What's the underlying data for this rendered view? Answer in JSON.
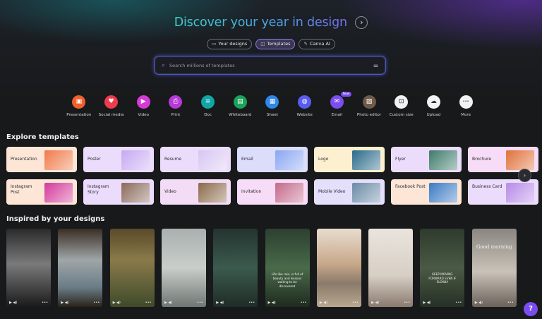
{
  "hero": {
    "title": "Discover your year in design",
    "arrow": "›"
  },
  "pills": [
    {
      "label": "Your designs",
      "icon": "folder-icon",
      "glyph": "▭"
    },
    {
      "label": "Templates",
      "icon": "templates-icon",
      "glyph": "◫"
    },
    {
      "label": "Canva AI",
      "icon": "canva-ai-icon",
      "glyph": "✎"
    }
  ],
  "search": {
    "placeholder": "Search millions of templates",
    "value": ""
  },
  "categories": [
    {
      "label": "Presentation",
      "color": "#f0602c",
      "glyph": "▣"
    },
    {
      "label": "Social media",
      "color": "#ef3b4b",
      "glyph": "♥"
    },
    {
      "label": "Video",
      "color": "#d63ad6",
      "glyph": "▶"
    },
    {
      "label": "Print",
      "color": "#b53ad6",
      "glyph": "⎙"
    },
    {
      "label": "Doc",
      "color": "#10a6a6",
      "glyph": "≡"
    },
    {
      "label": "Whiteboard",
      "color": "#1aa35a",
      "glyph": "▤"
    },
    {
      "label": "Sheet",
      "color": "#2f87e8",
      "glyph": "▦"
    },
    {
      "label": "Website",
      "color": "#5a5cf0",
      "glyph": "◍"
    },
    {
      "label": "Email",
      "color": "#7b4dee",
      "glyph": "✉",
      "badge": "New"
    },
    {
      "label": "Photo editor",
      "color": "#6f5a48",
      "glyph": "▨"
    },
    {
      "label": "Custom size",
      "color": "#f2f2f2",
      "glyph": "⊡"
    },
    {
      "label": "Upload",
      "color": "#f2f2f2",
      "glyph": "☁"
    },
    {
      "label": "More",
      "color": "#f2f2f2",
      "glyph": "•••"
    }
  ],
  "explore": {
    "title": "Explore templates",
    "scroll": "›"
  },
  "templates": [
    {
      "label": "Presentation",
      "bg": "#fde6d6",
      "thumb": "#f07a4a"
    },
    {
      "label": "Poster",
      "bg": "#ecdcfb",
      "thumb": "#c6a9f2"
    },
    {
      "label": "Resume",
      "bg": "#ecdcfb",
      "thumb": "#d7c6f2"
    },
    {
      "label": "Email",
      "bg": "#dcdcfb",
      "thumb": "#8aa6f2"
    },
    {
      "label": "Logo",
      "bg": "#fdf0d0",
      "thumb": "#2a6a8a"
    },
    {
      "label": "Flyer",
      "bg": "#ecdcfb",
      "thumb": "#3d7a6a"
    },
    {
      "label": "Brochure",
      "bg": "#f6dcf6",
      "thumb": "#e0713a"
    },
    {
      "label": "Instagram Post",
      "bg": "#fde6d6",
      "thumb": "#d43a9a"
    },
    {
      "label": "Instagram Story",
      "bg": "#ecdcfb",
      "thumb": "#8a6a5a"
    },
    {
      "label": "Video",
      "bg": "#f3dcf6",
      "thumb": "#8a6a4a"
    },
    {
      "label": "Invitation",
      "bg": "#f6dcf6",
      "thumb": "#c46a8a"
    },
    {
      "label": "Mobile Video",
      "bg": "#e4e0fb",
      "thumb": "#6a8aa6"
    },
    {
      "label": "Facebook Post",
      "bg": "#fde6d6",
      "thumb": "#3a7ac4"
    },
    {
      "label": "Business Card",
      "bg": "#ecdcfb",
      "thumb": "#b78ae8"
    }
  ],
  "inspired": {
    "title": "Inspired by your designs"
  },
  "designs": [
    {
      "bg": "linear-gradient(180deg,#2a2a2a,#7a7a7a 45%,#1a1a1a)",
      "caption": ""
    },
    {
      "bg": "linear-gradient(180deg,#3a2e24,#a0a6a8 40%,#6a7c86 75%,#2a2218)",
      "caption": ""
    },
    {
      "bg": "linear-gradient(180deg,#5a4a2a,#8a7a4a 40%,#3e4a2a)",
      "caption": ""
    },
    {
      "bg": "linear-gradient(180deg,#a9b0ae,#c9cecb 50%,#6f7672)",
      "caption": ""
    },
    {
      "bg": "linear-gradient(180deg,#23342e,#3c5a4e 50%,#1e2c26)",
      "caption": ""
    },
    {
      "bg": "linear-gradient(180deg,#2c4030,#4a6a4a 50%,#1e2a1e)",
      "caption": "Life like rain, is full of beauty and lessons waiting to be discovered"
    },
    {
      "bg": "linear-gradient(180deg,#e8dccf,#c8a88a 45%,#8a7a6a 70%,#b8a890)",
      "caption": ""
    },
    {
      "bg": "linear-gradient(180deg,#e9e4de,#d7cfc4 60%,#8a7a6e)",
      "caption": ""
    },
    {
      "bg": "linear-gradient(180deg,#2e3a2e,#4a5a44 50%,#263026)",
      "caption": "KEEP MOVING FORWARD EVEN IF SLOWLY"
    },
    {
      "bg": "linear-gradient(180deg,#8a8580,#c9c2b8 55%,#6a625a)",
      "caption": "Good morning"
    }
  ],
  "controls": {
    "play": "▶  ◀)",
    "more": "•••"
  },
  "help": {
    "label": "?"
  }
}
